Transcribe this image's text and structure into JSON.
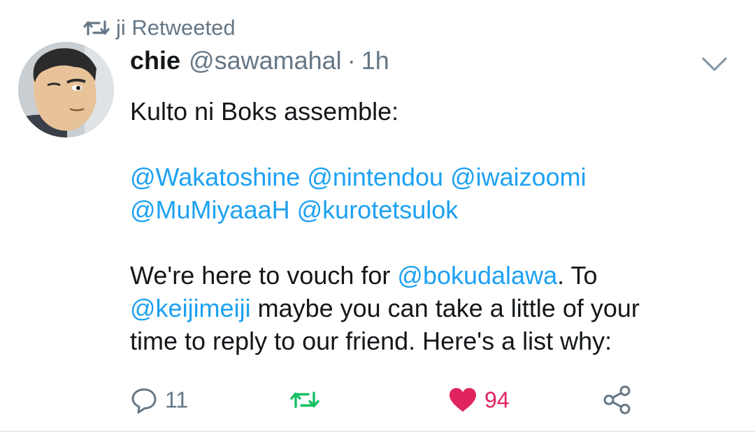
{
  "social_context": {
    "label": "ji Retweeted"
  },
  "author": {
    "display_name": "chie",
    "handle": "@sawamahal",
    "separator": "·",
    "time": "1h"
  },
  "tweet": {
    "line1": "Kulto ni Boks assemble:",
    "mentions_line1": [
      "@Wakatoshine",
      "@nintendou",
      "@iwaizoomi"
    ],
    "mentions_line2": [
      "@MuMiyaaaH",
      "@kurotetsulok"
    ],
    "para3_prefix": "We're here to vouch for ",
    "para3_mention1": "@bokudalawa",
    "para3_suffix1": ". To",
    "para3_mention2": "@keijimeiji",
    "para3_suffix2": " maybe you can take a little of your",
    "para3_line3": "time to reply to our friend. Here's a list why:"
  },
  "actions": {
    "reply_count": "11",
    "retweet_count": "",
    "like_count": "94"
  },
  "colors": {
    "link": "#1da1f2",
    "retweet_green": "#17bf63",
    "like_red": "#e0245e",
    "muted": "#657786"
  },
  "icons": [
    "retweet-icon",
    "chevron-down-icon",
    "reply-icon",
    "retweet-icon",
    "heart-icon",
    "share-icon"
  ]
}
